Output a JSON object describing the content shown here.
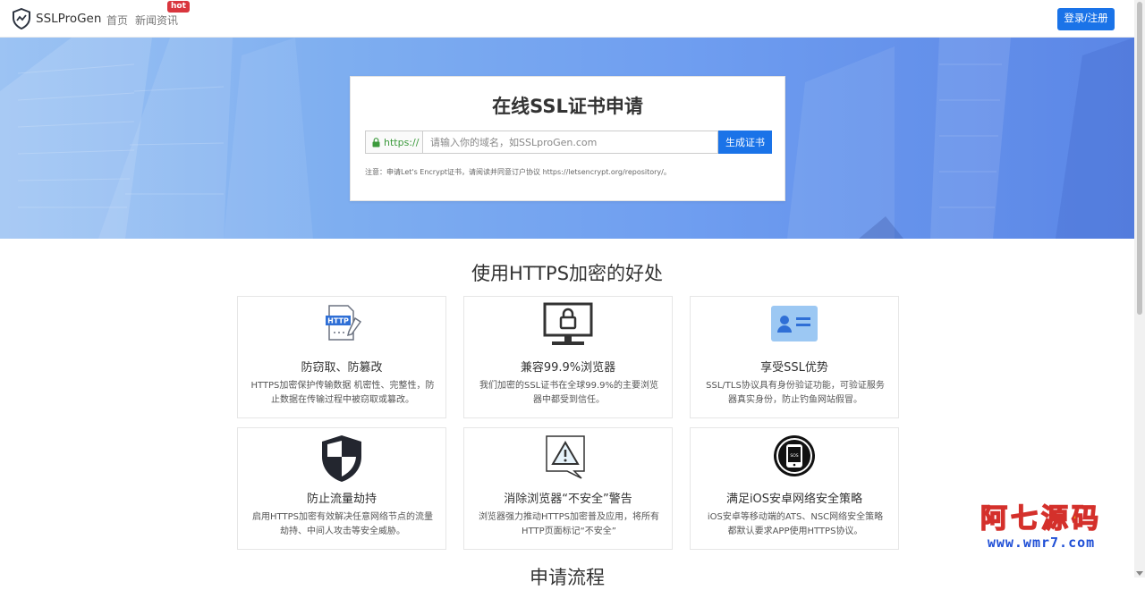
{
  "nav": {
    "brand": "SSLProGen",
    "home": "首页",
    "news": "新闻资讯",
    "hot_badge": "hot",
    "login": "登录/注册"
  },
  "hero": {
    "title": "在线SSL证书申请",
    "prefix": "https://",
    "input_value": "",
    "input_placeholder": "请输入你的域名，如SSLproGen.com",
    "button": "生成证书",
    "note": "注意：申请Let's Encrypt证书，请阅读并同意订户协议 https://letsencrypt.org/repository/。"
  },
  "benefits": {
    "title": "使用HTTPS加密的好处",
    "items": [
      {
        "icon": "http-document-icon",
        "title": "防窃取、防篡改",
        "desc": "HTTPS加密保护传输数据 机密性、完整性，防止数据在传输过程中被窃取或篡改。"
      },
      {
        "icon": "monitor-lock-icon",
        "title": "兼容99.9%浏览器",
        "desc": "我们加密的SSL证书在全球99.9%的主要浏览器中都受到信任。"
      },
      {
        "icon": "id-card-icon",
        "title": "享受SSL优势",
        "desc": "SSL/TLS协议具有身份验证功能，可验证服务器真实身份，防止钓鱼网站假冒。"
      },
      {
        "icon": "shield-icon",
        "title": "防止流量劫持",
        "desc": "启用HTTPS加密有效解决任意网络节点的流量劫持、中间人攻击等安全威胁。"
      },
      {
        "icon": "warning-bubble-icon",
        "title": "消除浏览器“不安全”警告",
        "desc": "浏览器强力推动HTTPS加密普及应用，将所有HTTP页面标记“不安全”"
      },
      {
        "icon": "phone-circle-icon",
        "title": "满足iOS安卓网络安全策略",
        "desc": "iOS安卓等移动端的ATS、NSC网络安全策略都默认要求APP使用HTTPS协议。"
      }
    ]
  },
  "next_section": {
    "title": "申请流程"
  },
  "watermark": {
    "line1": "阿七源码",
    "line2": "www.wmr7.com"
  }
}
